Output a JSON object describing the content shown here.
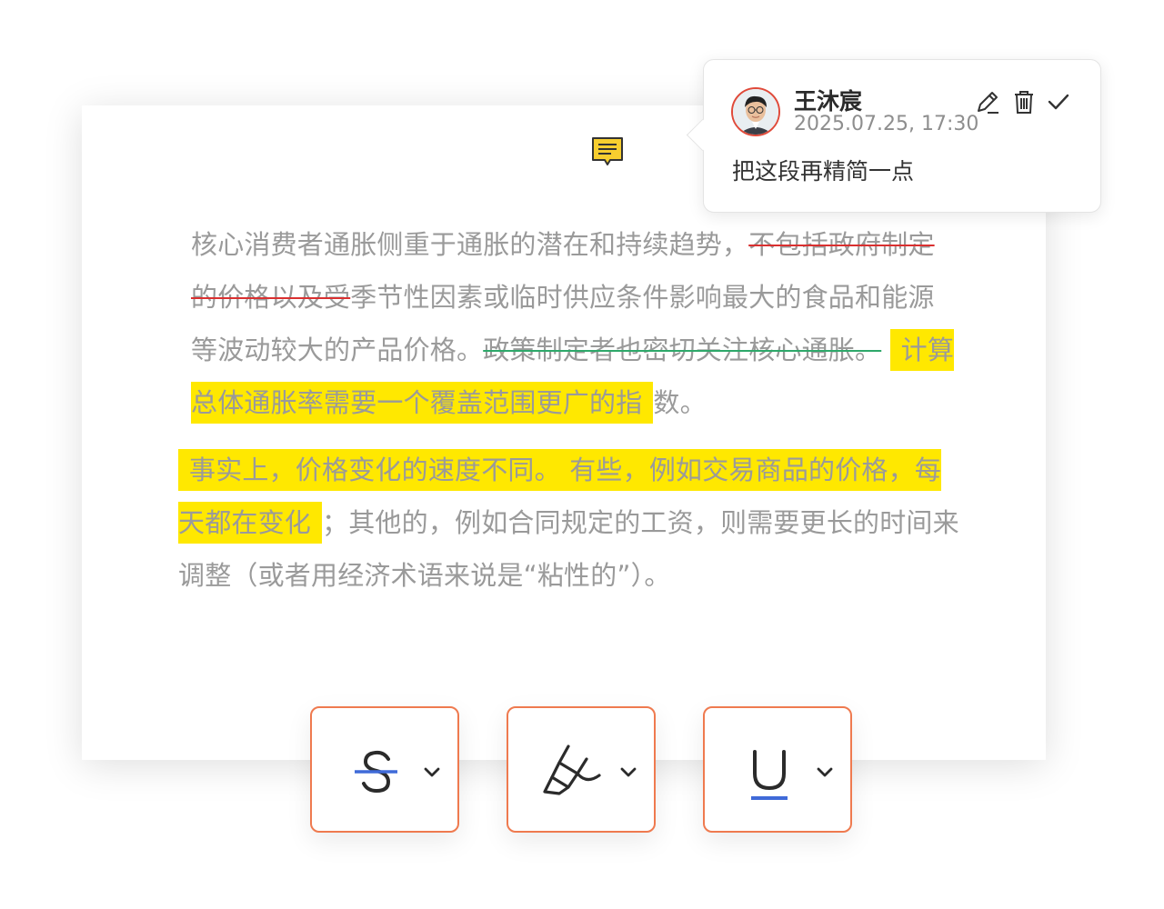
{
  "comment": {
    "author": "王沐宸",
    "timestamp": "2025.07.25, 17:30",
    "text": "把这段再精简一点"
  },
  "document": {
    "paragraph1": {
      "seg1": "核心消费者通胀侧重于通胀的潜在和持续趋势，",
      "seg2_strike_red": "不包括政府制定的价格以及受",
      "seg3": "季节性因素或临时供应条件影响最大的食品和能源等波动较大的产品价格。",
      "seg4_strike_green": "政策制定者也密切关注核心通胀。",
      "seg5_highlight": "计算总体通胀率需要一个覆盖范围更广的指",
      "seg6": "数。"
    },
    "paragraph2": {
      "seg1_highlight": "事实上，价格变化的速度不同。 有些，例如交易商品的价格，每天都在变化",
      "seg2": "；其他的，例如合同规定的工资，则需要更长的时间来调整（或者用经济术语来说是“粘性的”）。"
    }
  },
  "colors": {
    "strike_red": "#d93030",
    "strike_green": "#2ea86a",
    "highlight": "#ffe800",
    "tool_border": "#ef7a4f",
    "accent_blue": "#3f6ad8"
  },
  "icons": {
    "comment_marker": "comment-bubble-icon",
    "edit": "pencil-icon",
    "delete": "trash-icon",
    "resolve": "check-icon",
    "strikethrough": "strikethrough-icon",
    "highlight": "highlighter-icon",
    "underline": "underline-icon",
    "dropdown": "chevron-down-icon"
  }
}
